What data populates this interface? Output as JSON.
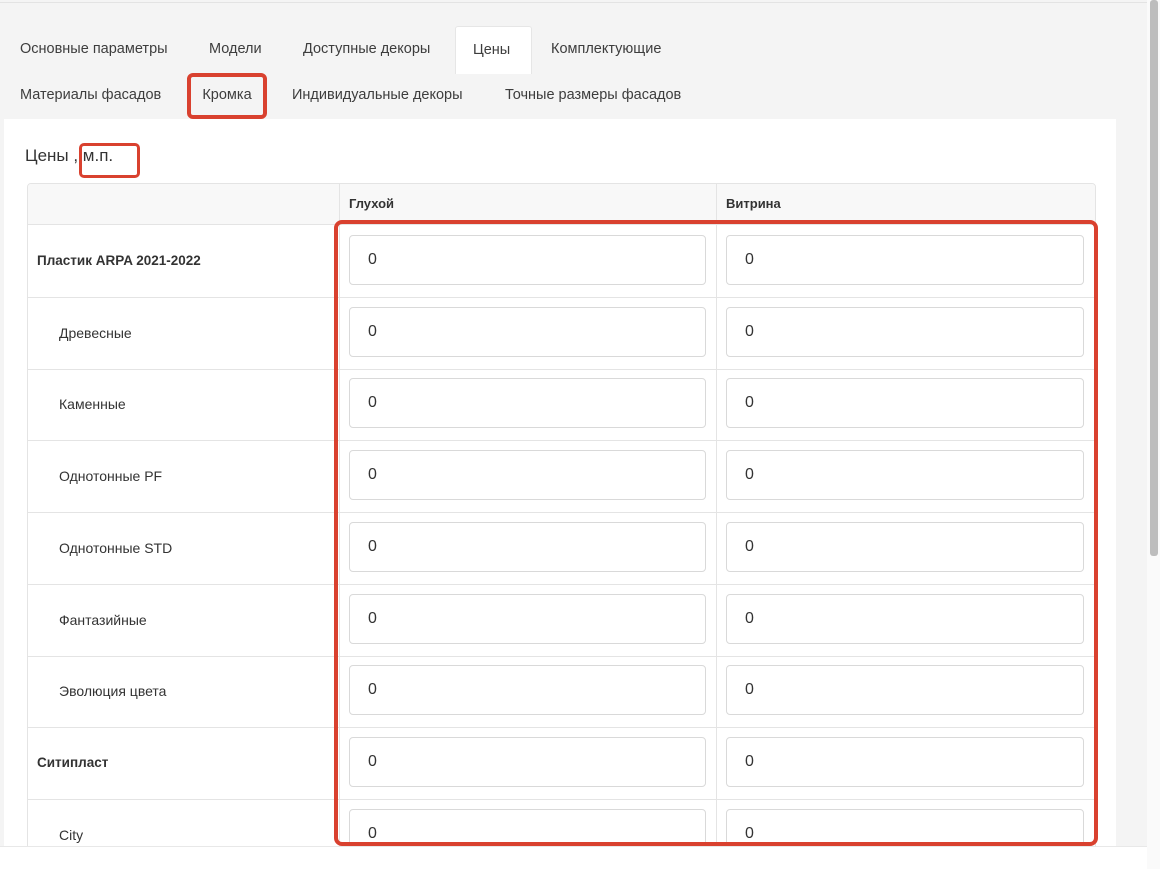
{
  "tabs_row1": [
    {
      "label": "Основные параметры",
      "active": false
    },
    {
      "label": "Модели",
      "active": false
    },
    {
      "label": "Доступные декоры",
      "active": false
    },
    {
      "label": "Цены",
      "active": true
    },
    {
      "label": "Комплектующие",
      "active": false
    }
  ],
  "tabs_row2": [
    {
      "label": "Материалы фасадов",
      "active": false
    },
    {
      "label": "Кромка",
      "active": false
    },
    {
      "label": "Индивидуальные декоры",
      "active": false
    },
    {
      "label": "Точные размеры фасадов",
      "active": false
    }
  ],
  "section": {
    "title": "Цены , м.п."
  },
  "table": {
    "columns": [
      "",
      "Глухой",
      "Витрина"
    ],
    "rows": [
      {
        "label": "Пластик ARPA 2021-2022",
        "group": true,
        "values": [
          "0",
          "0"
        ]
      },
      {
        "label": "Древесные",
        "group": false,
        "values": [
          "0",
          "0"
        ]
      },
      {
        "label": "Каменные",
        "group": false,
        "values": [
          "0",
          "0"
        ]
      },
      {
        "label": "Однотонные PF",
        "group": false,
        "values": [
          "0",
          "0"
        ]
      },
      {
        "label": "Однотонные STD",
        "group": false,
        "values": [
          "0",
          "0"
        ]
      },
      {
        "label": "Фантазийные",
        "group": false,
        "values": [
          "0",
          "0"
        ]
      },
      {
        "label": "Эволюция цвета",
        "group": false,
        "values": [
          "0",
          "0"
        ]
      },
      {
        "label": "Ситипласт",
        "group": true,
        "values": [
          "0",
          "0"
        ]
      },
      {
        "label": "City",
        "group": false,
        "values": [
          "0",
          "0"
        ]
      }
    ]
  },
  "colors": {
    "highlight": "#d9412f",
    "page_bg": "#f4f4f4",
    "panel_bg": "#ffffff"
  }
}
